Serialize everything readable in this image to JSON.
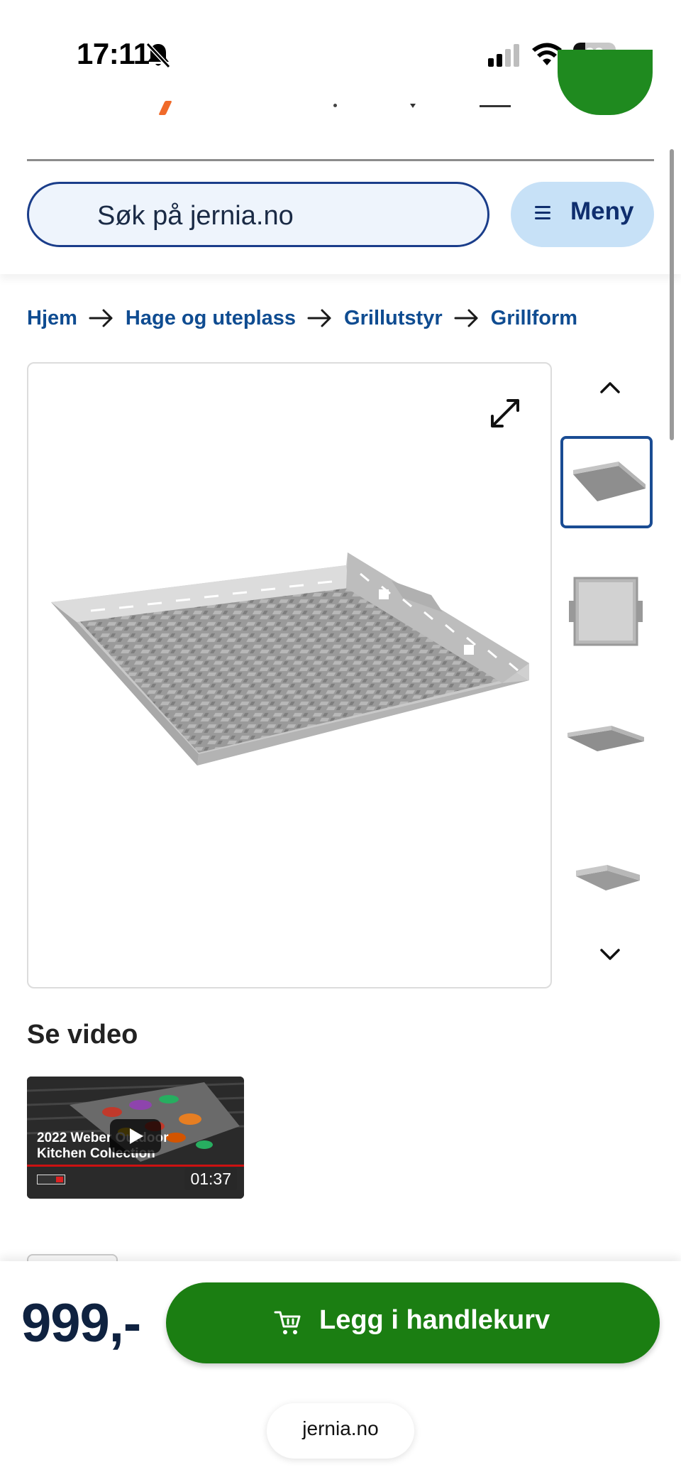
{
  "status_bar": {
    "time": "17:11",
    "battery_level": "29",
    "battery_fraction": 0.29
  },
  "search": {
    "placeholder": "Søk på jernia.no"
  },
  "menu": {
    "label": "Meny"
  },
  "breadcrumb": {
    "items": [
      "Hjem",
      "Hage og uteplass",
      "Grillutstyr",
      "Grillform"
    ]
  },
  "gallery": {
    "thumbnail_count": 4,
    "selected_index": 0
  },
  "video": {
    "section_title": "Se video",
    "caption": "2022 Weber Outdoor Kitchen Collection",
    "duration": "01:37"
  },
  "purchase": {
    "price": "999,-",
    "cart_label": "Legg i handlekurv"
  },
  "browser": {
    "url": "jernia.no"
  },
  "colors": {
    "primary_green": "#1b7e12",
    "link_blue": "#0f4c91",
    "menu_bg": "#c7e1f7",
    "search_border": "#1a3d8a",
    "price_navy": "#0f2240"
  }
}
